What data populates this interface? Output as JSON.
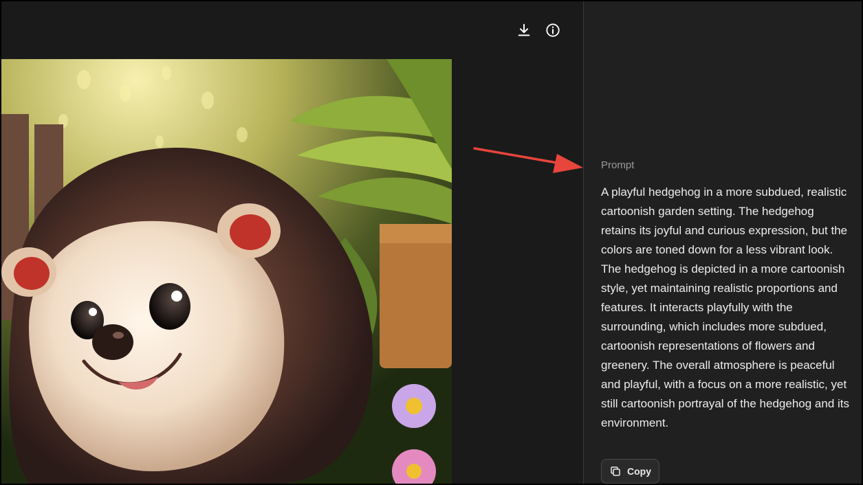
{
  "toolbar": {
    "download_icon": "download-icon",
    "info_icon": "info-icon"
  },
  "image": {
    "content": "hedgehog-garden-illustration"
  },
  "sidebar": {
    "prompt_label": "Prompt",
    "prompt_text": "A playful hedgehog in a more subdued, realistic cartoonish garden setting. The hedgehog retains its joyful and curious expression, but the colors are toned down for a less vibrant look. The hedgehog is depicted in a more cartoonish style, yet maintaining realistic proportions and features. It interacts playfully with the surrounding, which includes more subdued, cartoonish representations of flowers and greenery. The overall atmosphere is peaceful and playful, with a focus on a more realistic, yet still cartoonish portrayal of the hedgehog and its environment.",
    "copy_label": "Copy",
    "copy_icon": "copy-icon"
  },
  "annotation": {
    "arrow_color": "#e8453c"
  }
}
